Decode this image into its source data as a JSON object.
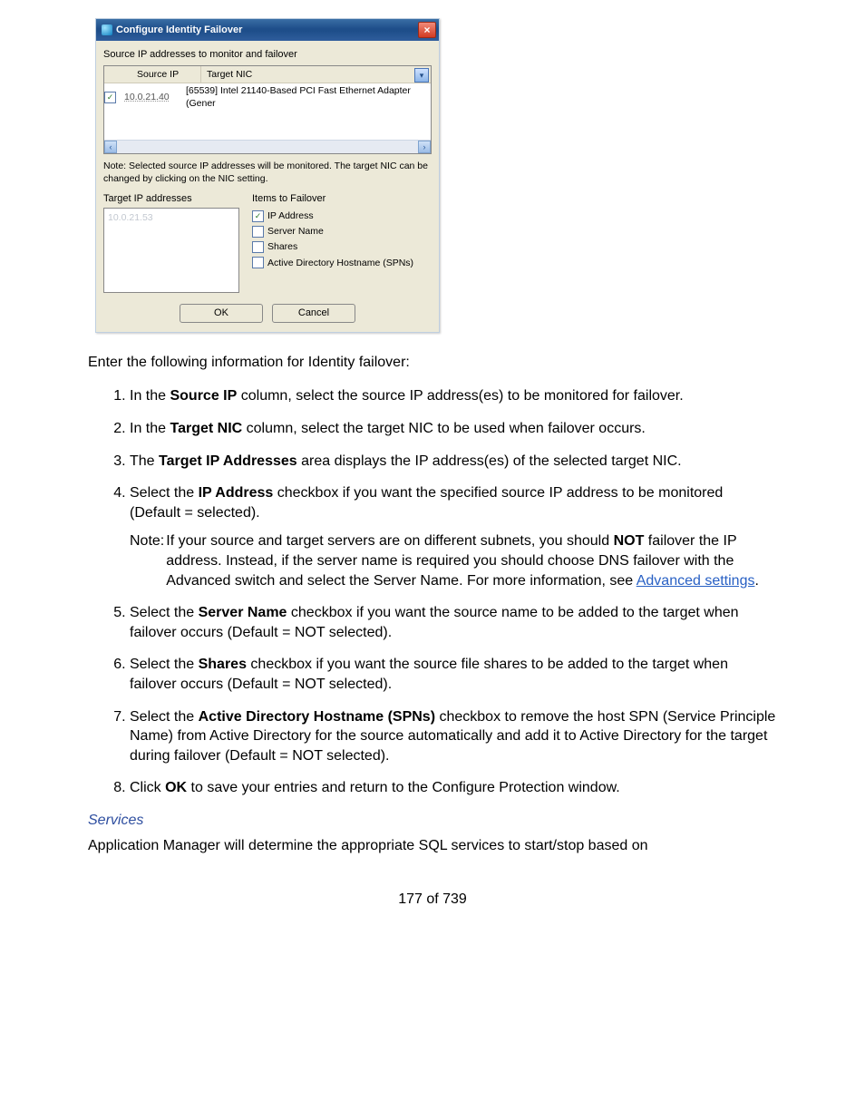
{
  "dialog": {
    "title": "Configure Identity Failover",
    "source_label": "Source IP addresses to monitor and failover",
    "cols": {
      "source_ip": "Source IP",
      "target_nic": "Target NIC"
    },
    "row": {
      "ip": "10.0.21.40",
      "nic": "[65539] Intel 21140-Based PCI Fast Ethernet Adapter (Gener"
    },
    "scroll": {
      "left": "‹",
      "right": "›"
    },
    "note": "Note: Selected source IP addresses will be monitored. The target NIC can be changed by clicking on the NIC setting.",
    "target_ip_label": "Target IP addresses",
    "target_ip_value": "10.0.21.53",
    "items_label": "Items to Failover",
    "items": {
      "ip_address": "IP Address",
      "server_name": "Server Name",
      "shares": "Shares",
      "spns": "Active Directory Hostname (SPNs)"
    },
    "check_mark": "✓",
    "buttons": {
      "ok": "OK",
      "cancel": "Cancel"
    },
    "close_x": "×"
  },
  "body": {
    "intro": "Enter the following information for Identity failover:",
    "step1_a": "In the ",
    "step1_b": "Source IP",
    "step1_c": " column, select the source IP address(es) to be monitored for failover.",
    "step2_a": "In the ",
    "step2_b": "Target NIC",
    "step2_c": " column, select the target NIC to be used when failover occurs.",
    "step3_a": "The ",
    "step3_b": "Target IP Addresses",
    "step3_c": " area displays the IP address(es) of the selected target NIC.",
    "step4_a": "Select the ",
    "step4_b": "IP Address",
    "step4_c": " checkbox if you want the specified source IP address to be monitored (Default = selected).",
    "note_label": "Note:",
    "note_a": "If your source and target servers are on different subnets, you should ",
    "note_b": "NOT",
    "note_c": " failover the IP address. Instead, if the server name is required you should choose DNS failover with the Advanced switch and select the Server Name. For more information, see ",
    "note_link": "Advanced settings",
    "note_d": ".",
    "step5_a": "Select the ",
    "step5_b": "Server Name",
    "step5_c": " checkbox if you want the source name to be added to the target when failover occurs (Default = NOT selected).",
    "step6_a": "Select the ",
    "step6_b": "Shares",
    "step6_c": " checkbox if you want the source file shares to be added to the target when failover occurs (Default = NOT selected).",
    "step7_a": "Select the ",
    "step7_b": "Active Directory Hostname (SPNs)",
    "step7_c": " checkbox to remove the host SPN (Service Principle Name) from Active Directory for the source automatically and add it to Active Directory for the target during failover (Default = NOT selected).",
    "step8_a": "Click ",
    "step8_b": "OK",
    "step8_c": " to save your entries and return to the Configure Protection window.",
    "services_heading": "Services",
    "services_para": "Application Manager will determine the appropriate SQL services to start/stop based on",
    "page_number": "177 of 739"
  }
}
